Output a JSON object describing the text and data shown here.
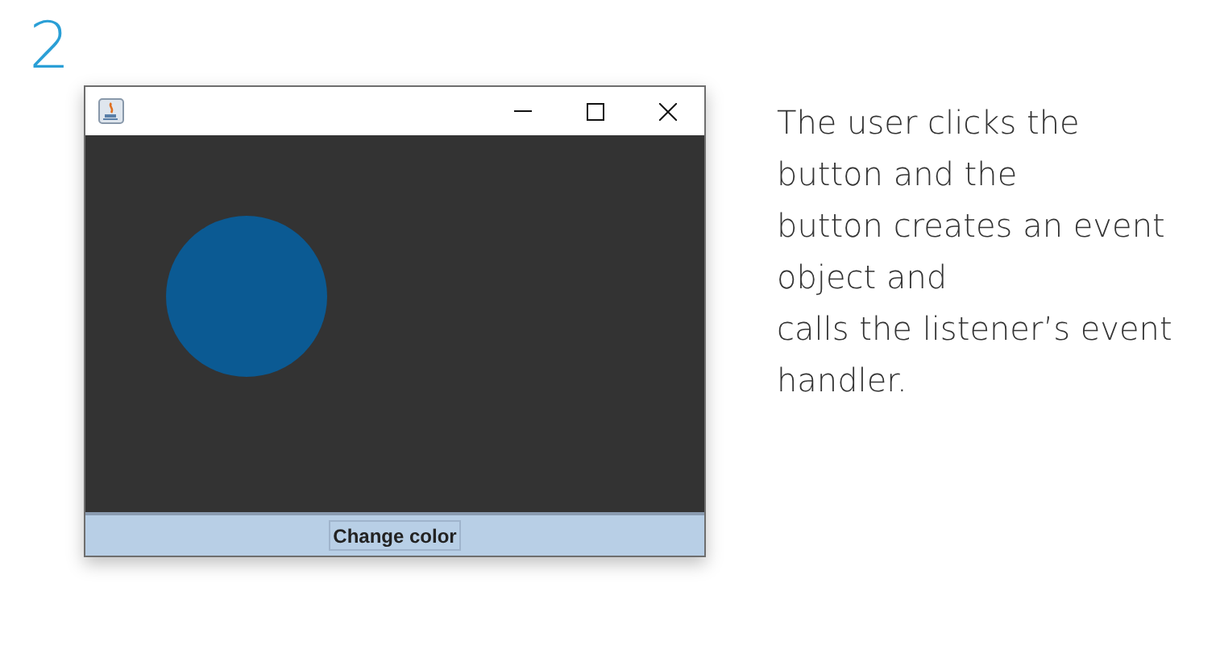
{
  "step_number": "2",
  "window": {
    "controls": [
      {
        "kind": "minimize"
      },
      {
        "kind": "maximize"
      },
      {
        "kind": "close"
      }
    ],
    "button": "Change color"
  },
  "caption_lines": [
    "The user clicks the",
    "button and the",
    "button creates an event",
    "object and",
    "calls the listener’s event",
    "handler."
  ]
}
